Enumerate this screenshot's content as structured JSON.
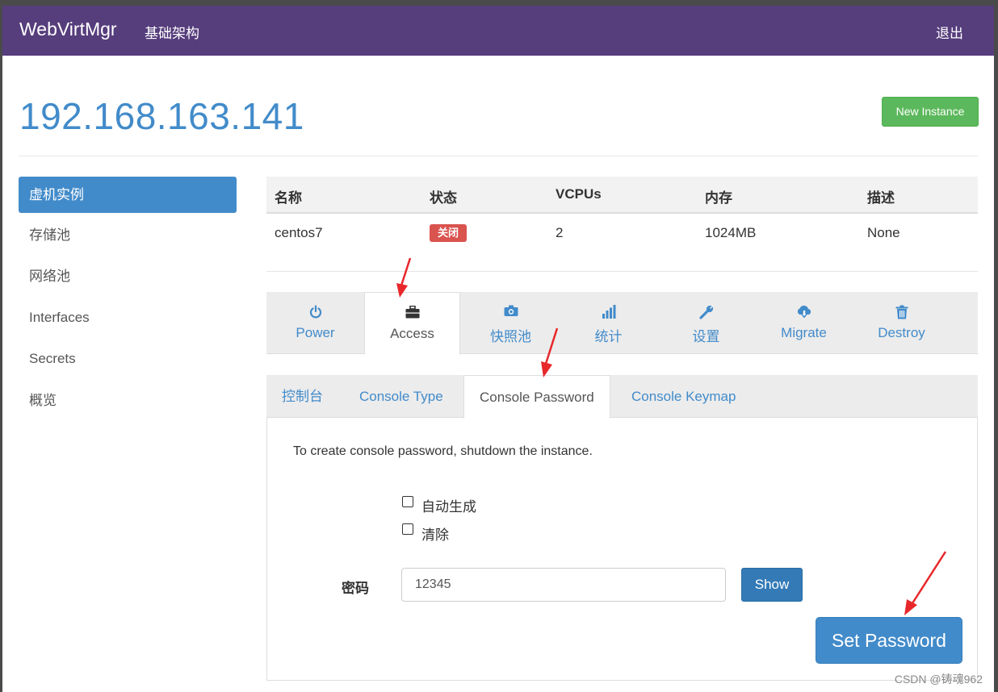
{
  "navbar": {
    "brand": "WebVirtMgr",
    "link": "基础架构",
    "logout": "退出"
  },
  "header": {
    "host": "192.168.163.141",
    "new_instance": "New Instance"
  },
  "sidebar": {
    "items": [
      {
        "label": "虚机实例",
        "active": true
      },
      {
        "label": "存储池"
      },
      {
        "label": "网络池"
      },
      {
        "label": "Interfaces"
      },
      {
        "label": "Secrets"
      },
      {
        "label": "概览"
      }
    ]
  },
  "table": {
    "headers": [
      "名称",
      "状态",
      "VCPUs",
      "内存",
      "描述"
    ],
    "row": {
      "name": "centos7",
      "status": "关闭",
      "vcpus": "2",
      "memory": "1024MB",
      "description": "None"
    }
  },
  "tabs": [
    {
      "label": "Power",
      "icon": "power-icon"
    },
    {
      "label": "Access",
      "icon": "briefcase-icon",
      "active": true
    },
    {
      "label": "快照池",
      "icon": "camera-icon"
    },
    {
      "label": "统计",
      "icon": "stats-icon"
    },
    {
      "label": "设置",
      "icon": "wrench-icon"
    },
    {
      "label": "Migrate",
      "icon": "cloud-download-icon"
    },
    {
      "label": "Destroy",
      "icon": "trash-icon"
    }
  ],
  "subtabs": [
    {
      "label": "控制台"
    },
    {
      "label": "Console Type"
    },
    {
      "label": "Console Password",
      "active": true
    },
    {
      "label": "Console Keymap"
    }
  ],
  "panel": {
    "info": "To create console password, shutdown the instance.",
    "auto_generate": "自动生成",
    "clear": "清除",
    "password_label": "密码",
    "password_value": "12345",
    "show_button": "Show",
    "set_button": "Set Password"
  },
  "watermark": "CSDN @铸魂962",
  "colors": {
    "navbar": "#563d7c",
    "primary": "#428bca",
    "success": "#5cb85c",
    "danger": "#d9534f",
    "annotation": "#e8272b"
  }
}
